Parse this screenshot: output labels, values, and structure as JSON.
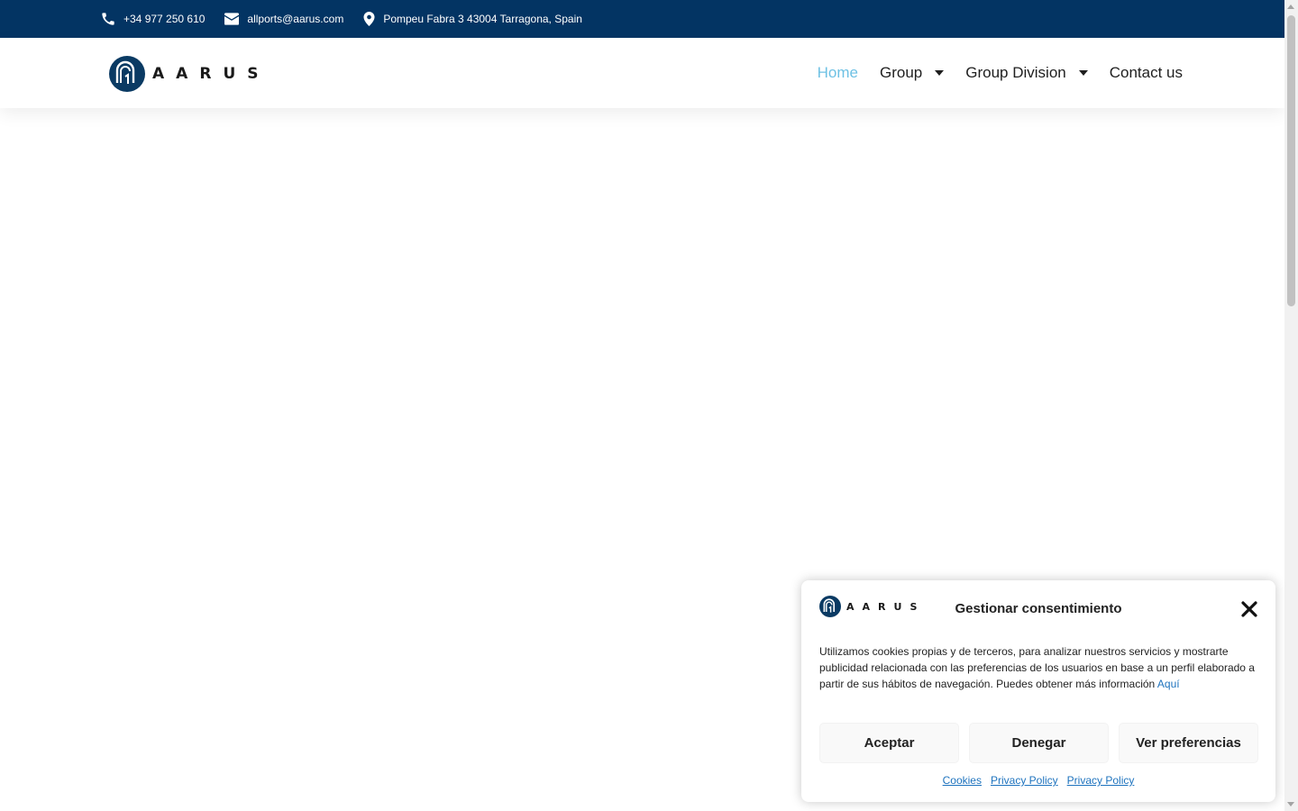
{
  "topbar": {
    "phone": "+34 977 250 610",
    "email": "allports@aarus.com",
    "address": "Pompeu Fabra 3 43004 Tarragona, Spain",
    "bg_color": "#033463"
  },
  "header": {
    "logo_letters": [
      "A",
      "A",
      "R",
      "U",
      "S"
    ],
    "nav": [
      {
        "label": "Home",
        "active": true,
        "dropdown": false
      },
      {
        "label": "Group",
        "active": false,
        "dropdown": true
      },
      {
        "label": "Group Division",
        "active": false,
        "dropdown": true
      },
      {
        "label": "Contact us",
        "active": false,
        "dropdown": false
      }
    ],
    "active_color": "#6ec1e4"
  },
  "cookie": {
    "title": "Gestionar consentimiento",
    "text": "Utilizamos cookies propias y de terceros, para analizar nuestros servicios y mostrarte publicidad relacionada con las preferencias de los usuarios en base a un perfil elaborado a partir de sus hábitos de navegación. Puedes obtener más información",
    "text_link": "Aquí",
    "buttons": {
      "accept": "Aceptar",
      "deny": "Denegar",
      "preferences": "Ver preferencias"
    },
    "links": [
      "Cookies",
      "Privacy Policy",
      "Privacy Policy"
    ],
    "link_color": "#1e73be"
  }
}
